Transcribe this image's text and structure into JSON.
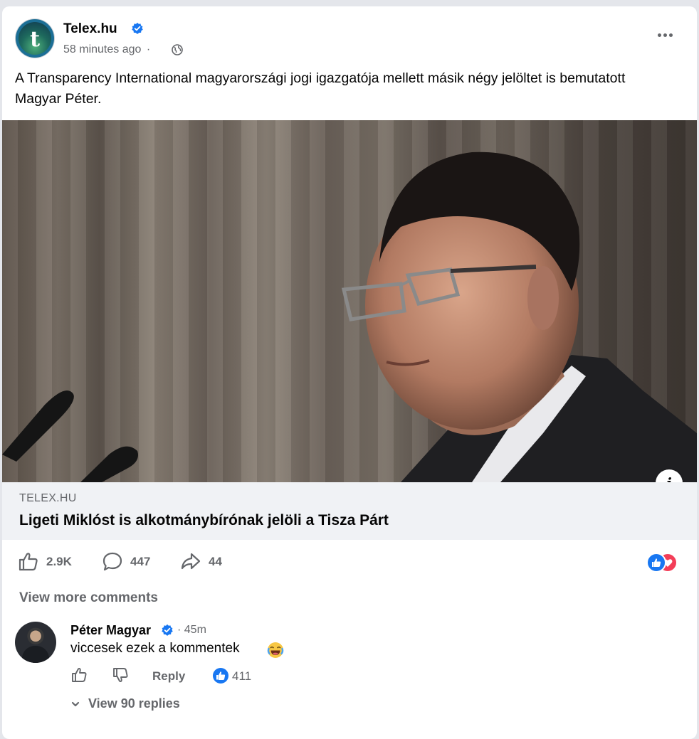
{
  "post": {
    "page_name": "Telex.hu",
    "time": "58 minutes ago",
    "separator": "·",
    "text": "A Transparency International magyarországi jogi igazgatója mellett másik négy jelöltet is bemutatott Magyar Péter."
  },
  "link": {
    "domain": "TELEX.HU",
    "title": "Ligeti Miklóst is alkotmánybírónak jelöli a Tisza Párt"
  },
  "stats": {
    "likes": "2.9K",
    "comments": "447",
    "shares": "44"
  },
  "comments_section": {
    "view_more": "View more comments",
    "comment": {
      "author": "Péter Magyar",
      "time": "· 45m",
      "text": "viccesek ezek a kommentek",
      "reply_label": "Reply",
      "like_count": "411",
      "view_replies": "View 90 replies"
    }
  },
  "colors": {
    "accent": "#1877f2",
    "love": "#f33e58",
    "secondary_text": "#65676b",
    "link_bar": "#f0f2f5"
  },
  "icons": [
    "verified-icon",
    "globe-icon",
    "more-icon",
    "info-icon",
    "like-icon",
    "comment-icon",
    "share-icon",
    "thumbs-down-icon",
    "laughing-emoji-icon",
    "chevron-down-icon"
  ]
}
